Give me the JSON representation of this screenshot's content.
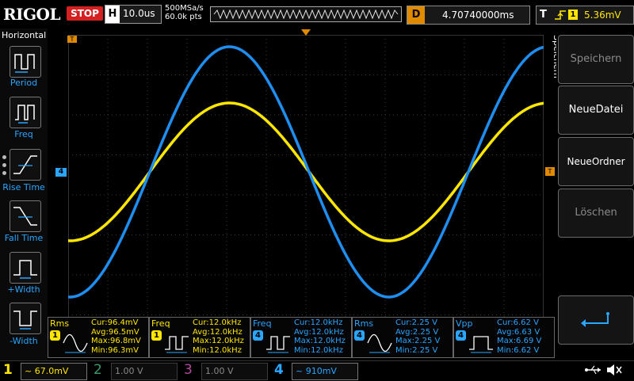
{
  "brand": {
    "logo": "RIGOL"
  },
  "status": {
    "run_state": "STOP"
  },
  "horizontal": {
    "label": "H",
    "timebase": "10.0us",
    "sample_rate": "500MSa/s",
    "points": "60.0k pts"
  },
  "delay": {
    "label": "D",
    "value": "4.70740000ms"
  },
  "trigger": {
    "label": "T",
    "level": "5.36mV"
  },
  "left_menu": {
    "title": "Horizontal",
    "items": [
      {
        "label": "Period"
      },
      {
        "label": "Freq"
      },
      {
        "label": "Rise Time"
      },
      {
        "label": "Fall Time"
      },
      {
        "label": "+Width"
      },
      {
        "label": "-Width"
      }
    ]
  },
  "right_menu": {
    "title": "Speichern",
    "items": [
      {
        "label": "Speichern",
        "enabled": false
      },
      {
        "label": "NeueDatei",
        "enabled": true
      },
      {
        "label": "NeueOrdner",
        "enabled": true
      },
      {
        "label": "Löschen",
        "enabled": false
      }
    ]
  },
  "markers": {
    "ch4_offset": "4",
    "trig_level": "T",
    "trig_pos": "T"
  },
  "measurements": [
    {
      "name": "Rms",
      "channel": "1",
      "color": "#ffe600",
      "cur": "Cur:96.4mV",
      "avg": "Avg:96.5mV",
      "max": "Max:96.8mV",
      "min": "Min:96.3mV"
    },
    {
      "name": "Freq",
      "channel": "1",
      "color": "#ffe600",
      "cur": "Cur:12.0kHz",
      "avg": "Avg:12.0kHz",
      "max": "Max:12.0kHz",
      "min": "Min:12.0kHz"
    },
    {
      "name": "Freq",
      "channel": "4",
      "color": "#2aa6ff",
      "cur": "Cur:12.0kHz",
      "avg": "Avg:12.0kHz",
      "max": "Max:12.0kHz",
      "min": "Min:12.0kHz"
    },
    {
      "name": "Rms",
      "channel": "4",
      "color": "#2aa6ff",
      "cur": "Cur:2.25 V",
      "avg": "Avg:2.25 V",
      "max": "Max:2.25 V",
      "min": "Min:2.25 V"
    },
    {
      "name": "Vpp",
      "channel": "4",
      "color": "#2aa6ff",
      "cur": "Cur:6.62 V",
      "avg": "Avg:6.63 V",
      "max": "Max:6.69 V",
      "min": "Min:6.62 V"
    }
  ],
  "channels": [
    {
      "num": "1",
      "scale": "67.0mV",
      "color": "#ffe600",
      "active": true
    },
    {
      "num": "2",
      "scale": "1.00 V",
      "color": "#3d9a6b",
      "active": false
    },
    {
      "num": "3",
      "scale": "1.00 V",
      "color": "#b04a9e",
      "active": false
    },
    {
      "num": "4",
      "scale": "910mV",
      "color": "#2aa6ff",
      "active": true
    }
  ],
  "traces": {
    "ch1": {
      "color": "#ffe600"
    },
    "ch4": {
      "color": "#1e8ef0"
    }
  }
}
